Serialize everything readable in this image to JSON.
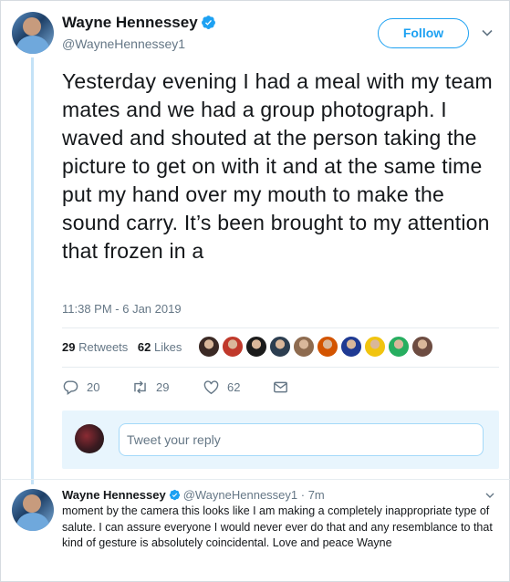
{
  "tweet": {
    "author_name": "Wayne Hennessey",
    "author_handle": "@WayneHennessey1",
    "follow_label": "Follow",
    "text": "Yesterday evening I had a meal with my team mates and we had a group photograph. I waved and shouted at the person taking the picture to get on with it and at the same time put my hand over my mouth to make the sound carry. It’s been brought to my attention that frozen in a",
    "timestamp": "11:38 PM - 6 Jan 2019",
    "retweets_count": "29",
    "retweets_label": "Retweets",
    "likes_count": "62",
    "likes_label": "Likes",
    "liker_avatars": [
      "#3b2a25",
      "#c0392b",
      "#1b1b1b",
      "#2c3e50",
      "#8e6b4f",
      "#d35400",
      "#1f3a93",
      "#f1c40f",
      "#27ae60",
      "#6d4c41"
    ],
    "reply_count": "20",
    "retweet_count": "29",
    "like_count": "62"
  },
  "reply_composer": {
    "placeholder": "Tweet your reply"
  },
  "reply": {
    "author_name": "Wayne Hennessey",
    "author_handle": "@WayneHennessey1",
    "time": "· 7m",
    "text": "moment by the camera this looks like I am making a completely inappropriate type of salute. I can assure everyone I would  never ever do that and any resemblance to that kind of gesture is absolutely coincidental. Love and peace Wayne"
  },
  "colors": {
    "accent": "#1da1f2",
    "muted": "#657786",
    "thread_line": "#c4e2f7"
  }
}
